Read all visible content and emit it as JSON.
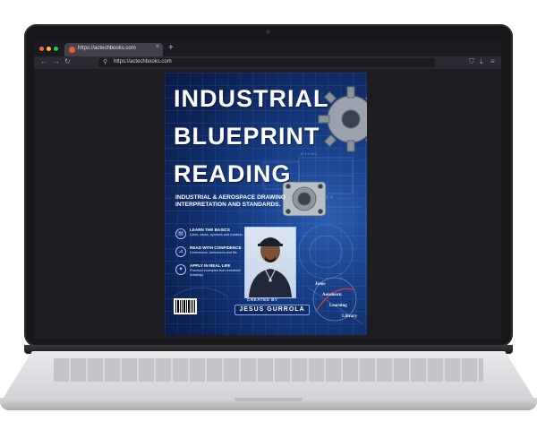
{
  "browser": {
    "tab_title": "https://actechbooks.com",
    "tab_close": "×",
    "new_tab": "+",
    "url": "https://actechbooks.com",
    "nav_back": "←",
    "nav_forward": "→",
    "nav_reload": "↻",
    "url_icon": "⚲",
    "shield_icon": "⛉",
    "download_icon": "⤓",
    "menu_icon": "≡"
  },
  "book_cover": {
    "title_line1": "INDUSTRIAL",
    "title_line2": "BLUEPRINT",
    "title_line3": "READING",
    "subtitle": "INDUSTRIAL & AEROSPACE DRAWING INTERPRETATION AND STANDARDS.",
    "features": [
      {
        "heading": "LEARN THE BASICS",
        "description": "Lines, views, symbols and notation"
      },
      {
        "heading": "READ WITH CONFIDENCE",
        "description": "Dimensions, tolerances and fits"
      },
      {
        "heading": "APPLY IN REAL LIFE",
        "description": "Practical examples from industrial drawings"
      }
    ],
    "created_by": "CREATED BY",
    "author": "JESUS GURROLA",
    "publisher_words": [
      "Jesus",
      "Aerolearn",
      "Learning",
      "Library"
    ]
  },
  "colors": {
    "cover_dark": "#0d2458",
    "cover_light": "#2c5db0",
    "window_red": "#ff5f57",
    "window_yellow": "#febc2e",
    "window_green": "#28c840"
  }
}
